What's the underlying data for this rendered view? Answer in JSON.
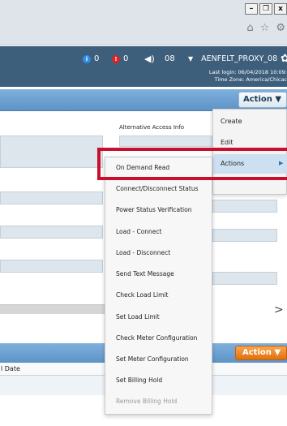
{
  "window": {
    "minimize_label": "–",
    "restore_label": "❐",
    "close_label": "x",
    "browser_icons": [
      "⌂",
      "☆",
      "⚙"
    ]
  },
  "header": {
    "info_count": "0",
    "alert_count": "0",
    "volume_icon": "speaker-icon",
    "volume_value": "08",
    "user_name": "AENFELT_PROXY_08",
    "last_login": "Last login: 06/04/2018 10:09:",
    "time_zone": "Time Zone: America/Chicac"
  },
  "toolbar": {
    "action_label": "Action ▼",
    "action_bottom_label": "Action ▼"
  },
  "form": {
    "alternative_access_label": "Alternative Access Info"
  },
  "table": {
    "column_header": "l Date"
  },
  "menu": {
    "items": [
      "Create",
      "Edit",
      "Actions"
    ]
  },
  "submenu": {
    "items": [
      "On Demand Read",
      "Connect/Disconnect Status",
      "Power Status Verification",
      "Load - Connect",
      "Load - Disconnect",
      "Send Text Message",
      "Check Load Limit",
      "Set Load Limit",
      "Check Meter Configuration",
      "Set Meter Configuration",
      "Set Billing Hold",
      "Remove Billing Hold"
    ],
    "disabled_item": "Remove Billing Hold"
  },
  "colors": {
    "header_bg": "#3d5f7c",
    "toolbar_blue": "#6a9fd1",
    "highlight_red": "#c8102e",
    "action_orange": "#e97e1f"
  }
}
